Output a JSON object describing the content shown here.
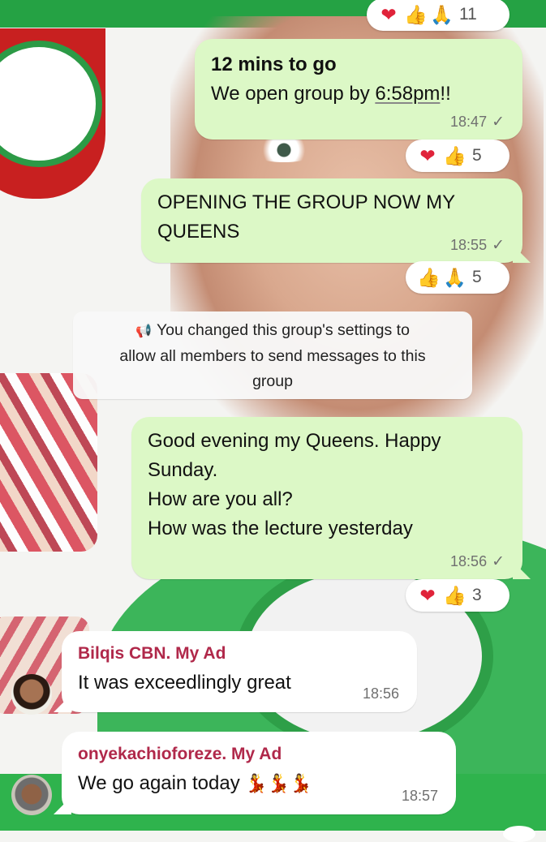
{
  "top_reactions": {
    "emojis": [
      "heart",
      "thumbs-up",
      "pray"
    ],
    "count": "11"
  },
  "messages": [
    {
      "id": "m1",
      "line1": "12 mins to go",
      "line2_prefix": "We open group by ",
      "line2_link": "6:58pm",
      "line2_suffix": "!!",
      "time": "18:47",
      "reactions": {
        "emojis": [
          "heart",
          "thumbs-up"
        ],
        "count": "5"
      }
    },
    {
      "id": "m2",
      "line1": "OPENING THE GROUP NOW MY",
      "line2": "QUEENS",
      "time": "18:55",
      "reactions": {
        "emojis": [
          "thumbs-up",
          "pray"
        ],
        "count": "5"
      }
    },
    {
      "id": "m3",
      "lines": [
        "Good evening my Queens. Happy",
        "Sunday.",
        "How are you all?",
        "How was the lecture yesterday"
      ],
      "time": "18:56",
      "reactions": {
        "emojis": [
          "heart",
          "thumbs-up"
        ],
        "count": "3"
      }
    }
  ],
  "system_notice": {
    "lines": [
      "You changed this group's settings to",
      "allow all members to send messages to this",
      "group"
    ]
  },
  "incoming": [
    {
      "sender": "Bilqis CBN. My Ad",
      "text": "It was exceedlingly great",
      "time": "18:56"
    },
    {
      "sender": "onyekachioforeze. My Ad",
      "text": "We go again today",
      "time": "18:57"
    }
  ],
  "colors": {
    "outgoing_bubble": "#dcf8c6",
    "sender_name": "#b0284a",
    "wallpaper_green": "#2fb34d"
  },
  "icons": {
    "check": "single-check-icon",
    "megaphone": "megaphone-icon",
    "dancer": "dancer-emoji"
  }
}
